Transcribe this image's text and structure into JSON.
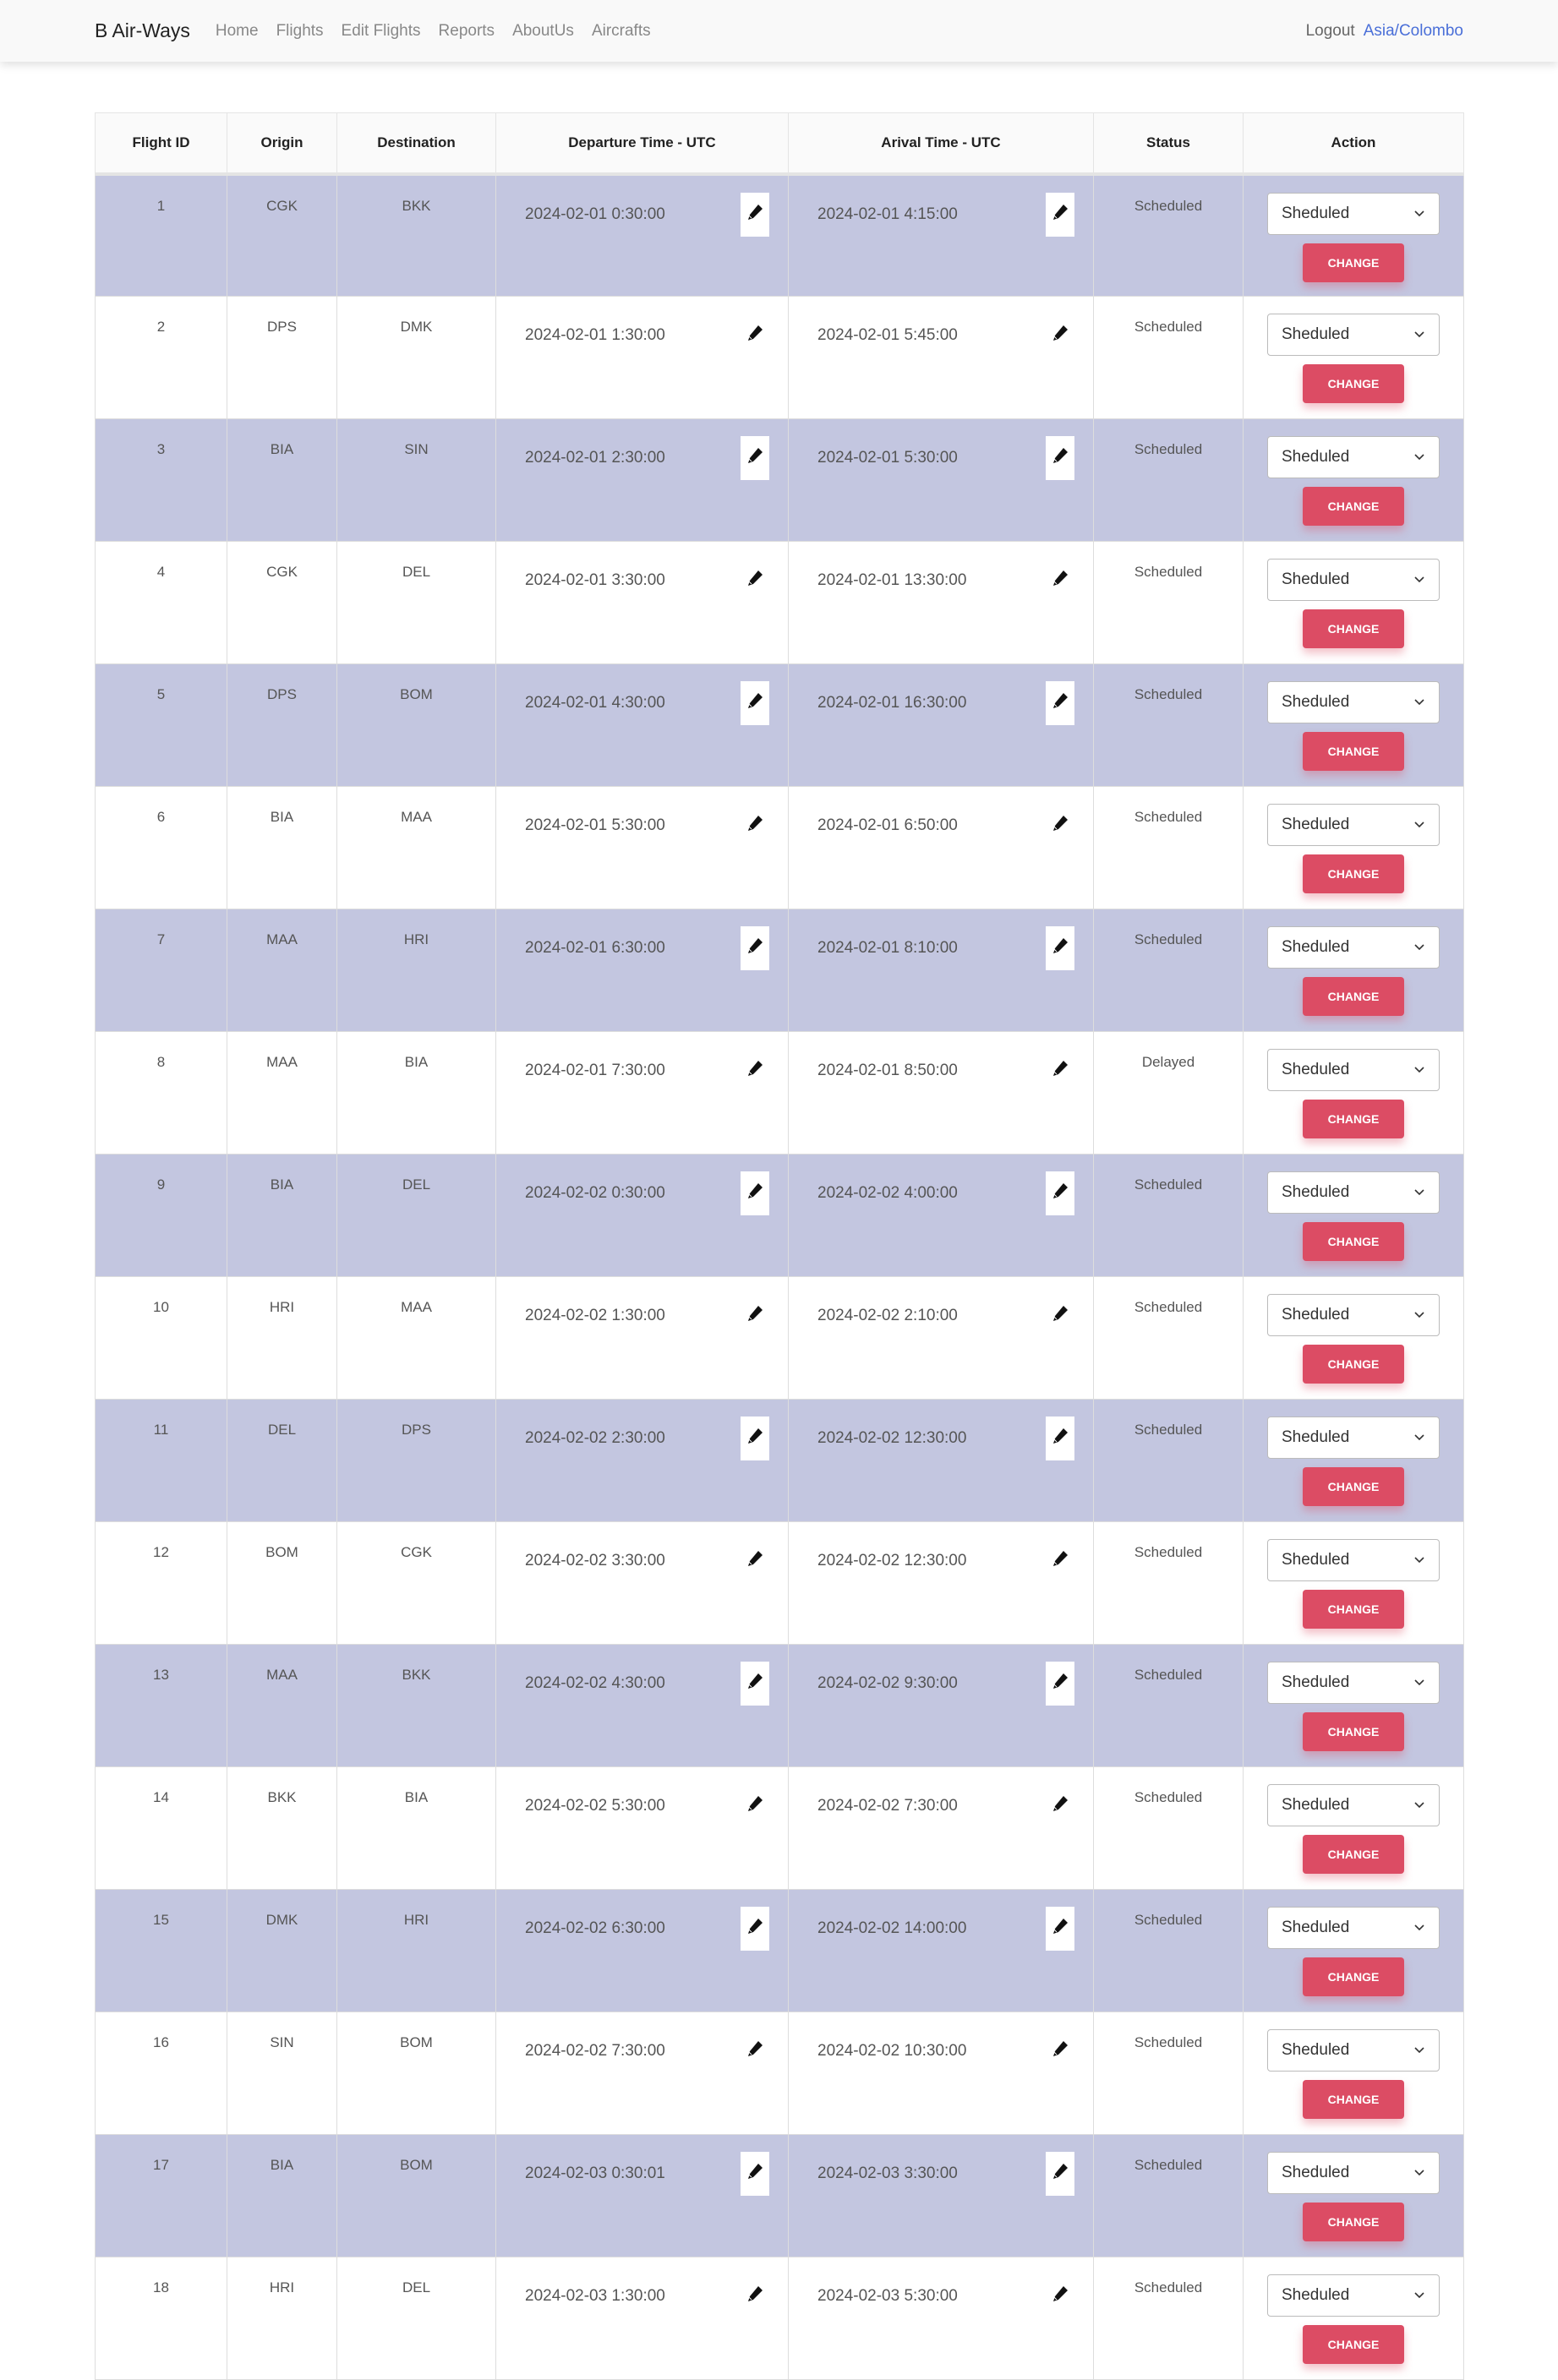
{
  "nav": {
    "brand": "B Air-Ways",
    "links": [
      "Home",
      "Flights",
      "Edit Flights",
      "Reports",
      "AboutUs",
      "Aircrafts"
    ],
    "logout": "Logout",
    "timezone": "Asia/Colombo"
  },
  "table": {
    "headers": [
      "Flight ID",
      "Origin",
      "Destination",
      "Departure Time - UTC",
      "Arival Time - UTC",
      "Status",
      "Action"
    ],
    "select_value": "Sheduled",
    "change_label": "CHANGE",
    "edit_icon": "pencil-icon",
    "rows": [
      {
        "id": "1",
        "origin": "CGK",
        "dest": "BKK",
        "dep": "2024-02-01 0:30:00",
        "arr": "2024-02-01 4:15:00",
        "status": "Scheduled"
      },
      {
        "id": "2",
        "origin": "DPS",
        "dest": "DMK",
        "dep": "2024-02-01 1:30:00",
        "arr": "2024-02-01 5:45:00",
        "status": "Scheduled"
      },
      {
        "id": "3",
        "origin": "BIA",
        "dest": "SIN",
        "dep": "2024-02-01 2:30:00",
        "arr": "2024-02-01 5:30:00",
        "status": "Scheduled"
      },
      {
        "id": "4",
        "origin": "CGK",
        "dest": "DEL",
        "dep": "2024-02-01 3:30:00",
        "arr": "2024-02-01 13:30:00",
        "status": "Scheduled"
      },
      {
        "id": "5",
        "origin": "DPS",
        "dest": "BOM",
        "dep": "2024-02-01 4:30:00",
        "arr": "2024-02-01 16:30:00",
        "status": "Scheduled"
      },
      {
        "id": "6",
        "origin": "BIA",
        "dest": "MAA",
        "dep": "2024-02-01 5:30:00",
        "arr": "2024-02-01 6:50:00",
        "status": "Scheduled"
      },
      {
        "id": "7",
        "origin": "MAA",
        "dest": "HRI",
        "dep": "2024-02-01 6:30:00",
        "arr": "2024-02-01 8:10:00",
        "status": "Scheduled"
      },
      {
        "id": "8",
        "origin": "MAA",
        "dest": "BIA",
        "dep": "2024-02-01 7:30:00",
        "arr": "2024-02-01 8:50:00",
        "status": "Delayed"
      },
      {
        "id": "9",
        "origin": "BIA",
        "dest": "DEL",
        "dep": "2024-02-02 0:30:00",
        "arr": "2024-02-02 4:00:00",
        "status": "Scheduled"
      },
      {
        "id": "10",
        "origin": "HRI",
        "dest": "MAA",
        "dep": "2024-02-02 1:30:00",
        "arr": "2024-02-02 2:10:00",
        "status": "Scheduled"
      },
      {
        "id": "11",
        "origin": "DEL",
        "dest": "DPS",
        "dep": "2024-02-02 2:30:00",
        "arr": "2024-02-02 12:30:00",
        "status": "Scheduled"
      },
      {
        "id": "12",
        "origin": "BOM",
        "dest": "CGK",
        "dep": "2024-02-02 3:30:00",
        "arr": "2024-02-02 12:30:00",
        "status": "Scheduled"
      },
      {
        "id": "13",
        "origin": "MAA",
        "dest": "BKK",
        "dep": "2024-02-02 4:30:00",
        "arr": "2024-02-02 9:30:00",
        "status": "Scheduled"
      },
      {
        "id": "14",
        "origin": "BKK",
        "dest": "BIA",
        "dep": "2024-02-02 5:30:00",
        "arr": "2024-02-02 7:30:00",
        "status": "Scheduled"
      },
      {
        "id": "15",
        "origin": "DMK",
        "dest": "HRI",
        "dep": "2024-02-02 6:30:00",
        "arr": "2024-02-02 14:00:00",
        "status": "Scheduled"
      },
      {
        "id": "16",
        "origin": "SIN",
        "dest": "BOM",
        "dep": "2024-02-02 7:30:00",
        "arr": "2024-02-02 10:30:00",
        "status": "Scheduled"
      },
      {
        "id": "17",
        "origin": "BIA",
        "dest": "BOM",
        "dep": "2024-02-03 0:30:01",
        "arr": "2024-02-03 3:30:00",
        "status": "Scheduled"
      },
      {
        "id": "18",
        "origin": "HRI",
        "dest": "DEL",
        "dep": "2024-02-03 1:30:00",
        "arr": "2024-02-03 5:30:00",
        "status": "Scheduled"
      }
    ]
  }
}
